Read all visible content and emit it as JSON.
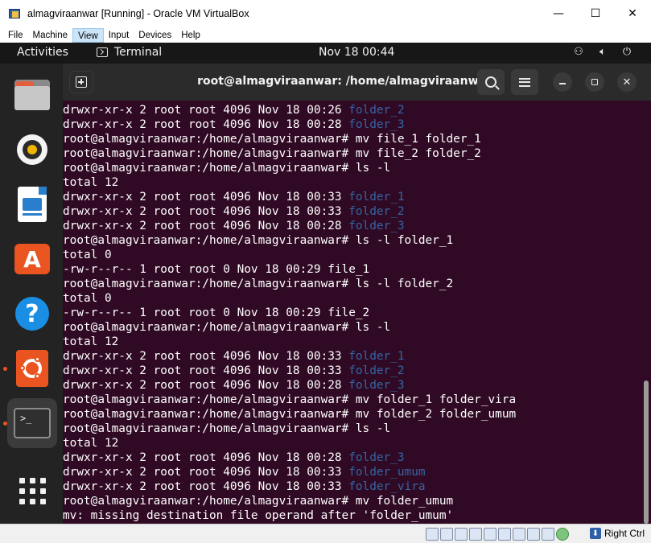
{
  "host_window": {
    "title": "almagviraanwar [Running] - Oracle VM VirtualBox",
    "controls": {
      "minimize": "—",
      "maximize": "☐",
      "close": "✕"
    }
  },
  "host_menu": [
    "File",
    "Machine",
    "View",
    "Input",
    "Devices",
    "Help"
  ],
  "host_menu_active": "View",
  "gnome_topbar": {
    "activities": "Activities",
    "app_name": "Terminal",
    "clock": "Nov 18  00:44"
  },
  "dock": {
    "items": [
      "files-icon",
      "rhythmbox-icon",
      "writer-icon",
      "software-center-icon",
      "help-icon",
      "ubuntu-icon",
      "terminal-icon",
      "app-grid-icon"
    ],
    "terminal_glyph": ">_",
    "store_glyph": "A",
    "help_glyph": "?"
  },
  "terminal": {
    "title": "root@almagviraanwar: /home/almagviraanwar",
    "prompt": "root@almagviraanwar:/home/almagviraanwar# ",
    "lines": [
      {
        "text": "drwxr-xr-x 2 root root 4096 Nov 18 00:26 ",
        "dir": "folder_2"
      },
      {
        "text": "drwxr-xr-x 2 root root 4096 Nov 18 00:28 ",
        "dir": "folder_3"
      },
      {
        "text": "root@almagviraanwar:/home/almagviraanwar# mv file_1 folder_1"
      },
      {
        "text": "root@almagviraanwar:/home/almagviraanwar# mv file_2 folder_2"
      },
      {
        "text": "root@almagviraanwar:/home/almagviraanwar# ls -l"
      },
      {
        "text": "total 12"
      },
      {
        "text": "drwxr-xr-x 2 root root 4096 Nov 18 00:33 ",
        "dir": "folder_1"
      },
      {
        "text": "drwxr-xr-x 2 root root 4096 Nov 18 00:33 ",
        "dir": "folder_2"
      },
      {
        "text": "drwxr-xr-x 2 root root 4096 Nov 18 00:28 ",
        "dir": "folder_3"
      },
      {
        "text": "root@almagviraanwar:/home/almagviraanwar# ls -l folder_1"
      },
      {
        "text": "total 0"
      },
      {
        "text": "-rw-r--r-- 1 root root 0 Nov 18 00:29 file_1"
      },
      {
        "text": "root@almagviraanwar:/home/almagviraanwar# ls -l folder_2"
      },
      {
        "text": "total 0"
      },
      {
        "text": "-rw-r--r-- 1 root root 0 Nov 18 00:29 file_2"
      },
      {
        "text": "root@almagviraanwar:/home/almagviraanwar# ls -l"
      },
      {
        "text": "total 12"
      },
      {
        "text": "drwxr-xr-x 2 root root 4096 Nov 18 00:33 ",
        "dir": "folder_1"
      },
      {
        "text": "drwxr-xr-x 2 root root 4096 Nov 18 00:33 ",
        "dir": "folder_2"
      },
      {
        "text": "drwxr-xr-x 2 root root 4096 Nov 18 00:28 ",
        "dir": "folder_3"
      },
      {
        "text": "root@almagviraanwar:/home/almagviraanwar# mv folder_1 folder_vira"
      },
      {
        "text": "root@almagviraanwar:/home/almagviraanwar# mv folder_2 folder_umum"
      },
      {
        "text": "root@almagviraanwar:/home/almagviraanwar# ls -l"
      },
      {
        "text": "total 12"
      },
      {
        "text": "drwxr-xr-x 2 root root 4096 Nov 18 00:28 ",
        "dir": "folder_3"
      },
      {
        "text": "drwxr-xr-x 2 root root 4096 Nov 18 00:33 ",
        "dir": "folder_umum"
      },
      {
        "text": "drwxr-xr-x 2 root root 4096 Nov 18 00:33 ",
        "dir": "folder_vira"
      },
      {
        "text": "root@almagviraanwar:/home/almagviraanwar# mv folder_umum"
      },
      {
        "text": "mv: missing destination file operand after 'folder_umum'"
      }
    ]
  },
  "statusbar": {
    "host_key": "Right Ctrl"
  },
  "colors": {
    "terminal_bg": "#300a24",
    "directory": "#3465a4",
    "accent": "#e95420"
  }
}
